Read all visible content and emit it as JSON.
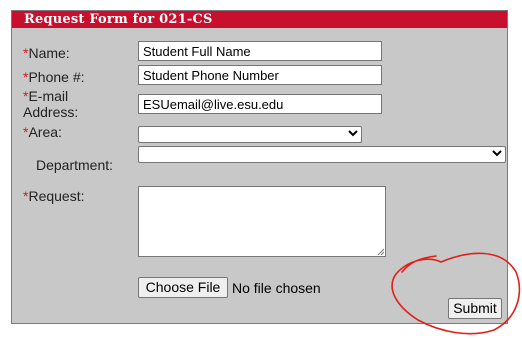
{
  "form": {
    "title": "Request Form for 021-CS",
    "fields": {
      "name": {
        "required_mark": "*",
        "label": "Name:",
        "value": "Student Full Name"
      },
      "phone": {
        "required_mark": "*",
        "label": "Phone #:",
        "value": "Student Phone Number"
      },
      "email": {
        "required_mark": "*",
        "label_line1": "E-mail",
        "label_line2": "Address:",
        "value": "ESUemail@live.esu.edu"
      },
      "area": {
        "required_mark": "*",
        "label": "Area:",
        "selected": ""
      },
      "department": {
        "label": "Department:",
        "selected": ""
      },
      "request": {
        "required_mark": "*",
        "label": "Request:",
        "value": ""
      }
    },
    "file_upload": {
      "button_label": "Choose File",
      "status": "No file chosen"
    },
    "submit_label": "Submit"
  },
  "icons": {
    "select_arrow": "chevron-down-icon",
    "textarea_resize": "resize-grip-icon"
  },
  "colors": {
    "header": "#c8102e",
    "panel_background": "#c8c8c8",
    "required_marker": "#d01c1c",
    "annotation_circle": "#e0201a"
  }
}
